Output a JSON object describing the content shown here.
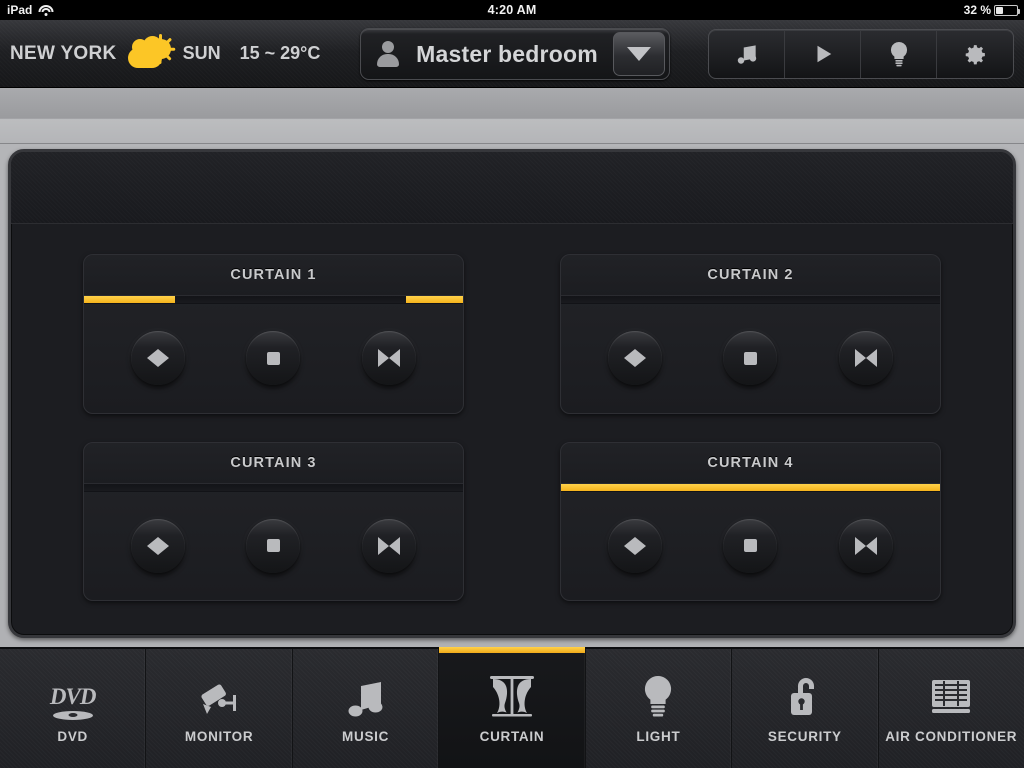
{
  "statusbar": {
    "device": "iPad",
    "wifi_icon": "wifi-icon",
    "time": "4:20 AM",
    "battery_percent": "32 %",
    "battery_icon": "battery-icon",
    "battery_level": 32
  },
  "header": {
    "city": "NEW YORK",
    "weather_icon": "sun-behind-cloud-icon",
    "day": "SUN",
    "temperature": "15 ~ 29°C",
    "room": {
      "person_icon": "person-icon",
      "name": "Master bedroom",
      "dropdown_icon": "chevron-down-icon"
    },
    "quick_icons": [
      {
        "name": "music-icon",
        "label": "Music"
      },
      {
        "name": "play-icon",
        "label": "Play"
      },
      {
        "name": "light-bulb-icon",
        "label": "Light"
      },
      {
        "name": "gear-icon",
        "label": "Settings"
      }
    ]
  },
  "curtains": [
    {
      "title": "CURTAIN 1",
      "position_segments": [
        {
          "start": 0,
          "width": 24
        },
        {
          "start": 85,
          "width": 15
        }
      ],
      "buttons": [
        {
          "name": "open-button",
          "icon": "arrows-outward-icon"
        },
        {
          "name": "stop-button",
          "icon": "square-stop-icon"
        },
        {
          "name": "close-button",
          "icon": "arrows-inward-icon"
        }
      ]
    },
    {
      "title": "CURTAIN 2",
      "position_segments": [],
      "buttons": [
        {
          "name": "open-button",
          "icon": "arrows-outward-icon"
        },
        {
          "name": "stop-button",
          "icon": "square-stop-icon"
        },
        {
          "name": "close-button",
          "icon": "arrows-inward-icon"
        }
      ]
    },
    {
      "title": "CURTAIN 3",
      "position_segments": [],
      "buttons": [
        {
          "name": "open-button",
          "icon": "arrows-outward-icon"
        },
        {
          "name": "stop-button",
          "icon": "square-stop-icon"
        },
        {
          "name": "close-button",
          "icon": "arrows-inward-icon"
        }
      ]
    },
    {
      "title": "CURTAIN 4",
      "position_segments": [
        {
          "start": 0,
          "width": 100
        }
      ],
      "buttons": [
        {
          "name": "open-button",
          "icon": "arrows-outward-icon"
        },
        {
          "name": "stop-button",
          "icon": "square-stop-icon"
        },
        {
          "name": "close-button",
          "icon": "arrows-inward-icon"
        }
      ]
    }
  ],
  "tabs": [
    {
      "label": "DVD",
      "icon": "dvd-icon",
      "active": false
    },
    {
      "label": "MONITOR",
      "icon": "security-camera-icon",
      "active": false
    },
    {
      "label": "MUSIC",
      "icon": "music-note-icon",
      "active": false
    },
    {
      "label": "CURTAIN",
      "icon": "curtain-icon",
      "active": true
    },
    {
      "label": "LIGHT",
      "icon": "light-bulb-icon",
      "active": false
    },
    {
      "label": "SECURITY",
      "icon": "open-padlock-icon",
      "active": false
    },
    {
      "label": "AIR CONDITIONER",
      "icon": "air-vent-icon",
      "active": false
    }
  ],
  "colors": {
    "accent": "#f5b31c",
    "panel_bg": "#1c1d21",
    "text": "#cbccce",
    "bezel": "#b4b5b8"
  }
}
